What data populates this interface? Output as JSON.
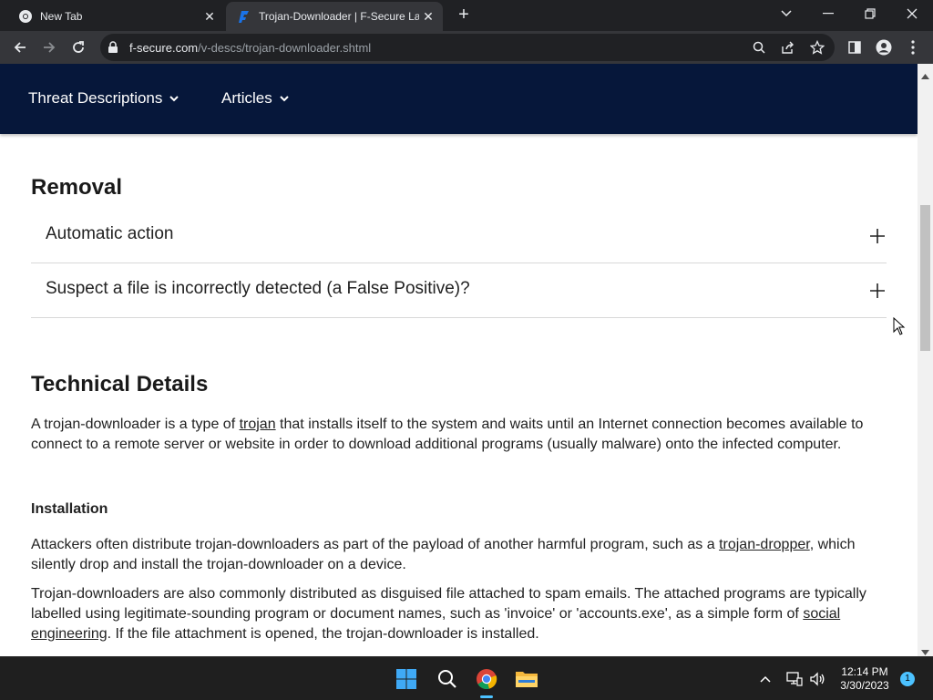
{
  "browser": {
    "tabs": [
      {
        "title": "New Tab",
        "favicon": "chrome-icon",
        "active": false
      },
      {
        "title": "Trojan-Downloader | F-Secure La",
        "favicon": "f-secure-icon",
        "active": true
      }
    ],
    "url_host": "f-secure.com",
    "url_path": "/v-descs/trojan-downloader.shtml"
  },
  "site_nav": {
    "items": [
      {
        "label": "Threat Descriptions"
      },
      {
        "label": "Articles"
      }
    ]
  },
  "removal": {
    "heading": "Removal",
    "accordion": [
      {
        "label": "Automatic action"
      },
      {
        "label": "Suspect a file is incorrectly detected (a False Positive)?"
      }
    ]
  },
  "technical": {
    "heading": "Technical Details",
    "intro_before": "A trojan-downloader is a type of ",
    "intro_link": "trojan",
    "intro_after": " that installs itself to the system and waits until an Internet connection becomes available to connect to a remote server or website in order to download additional programs (usually malware) onto the infected computer.",
    "installation_heading": "Installation",
    "p1_before": "Attackers often distribute trojan-downloaders as part of the payload of another harmful program, such as a ",
    "p1_link": "trojan-dropper",
    "p1_after": ", which silently drop and install the trojan-downloader on a device.",
    "p2_before": "Trojan-downloaders are also commonly distributed as disguised file attached to spam emails. The attached programs are typically labelled using legitimate-sounding program or document names, such as 'invoice' or 'accounts.exe', as a simple form of ",
    "p2_link": "social engineering",
    "p2_after": ". If the file attachment is opened, the trojan-downloader is installed."
  },
  "taskbar": {
    "time": "12:14 PM",
    "date": "3/30/2023",
    "notification_count": "1"
  },
  "colors": {
    "nav_background": "#06173a",
    "tab_active": "#35363a",
    "tab_strip": "#202124",
    "accent": "#4cc2ff"
  }
}
